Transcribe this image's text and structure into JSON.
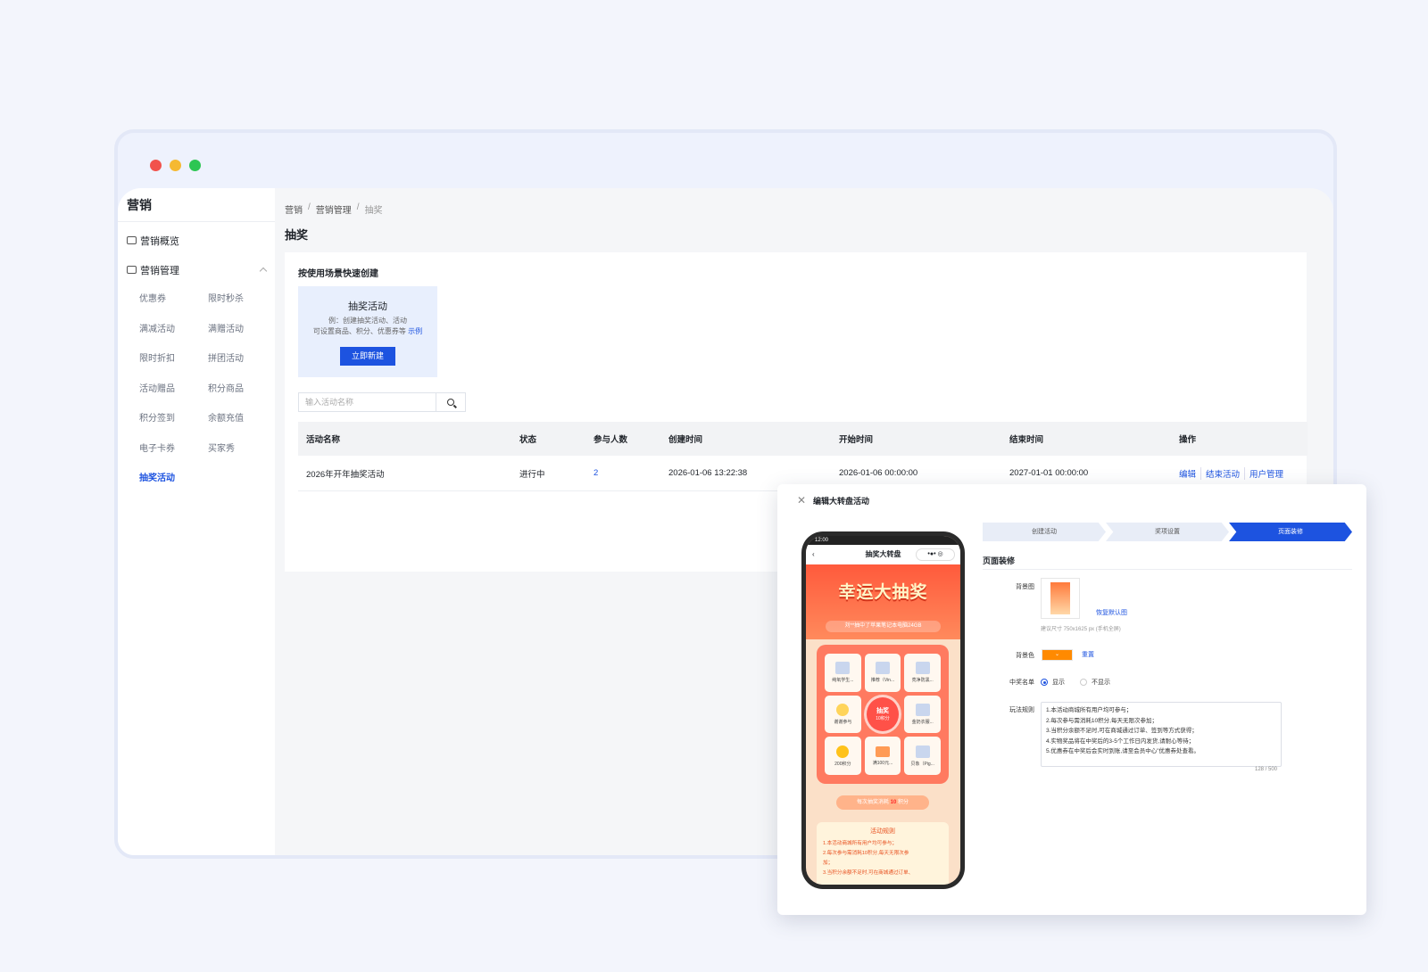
{
  "window": {
    "controls": [
      "close",
      "minimize",
      "maximize"
    ]
  },
  "sidebar": {
    "title": "营销",
    "overview": "营销概览",
    "management": "营销管理",
    "items": [
      "优惠券",
      "限时秒杀",
      "满减活动",
      "满赠活动",
      "限时折扣",
      "拼团活动",
      "活动赠品",
      "积分商品",
      "积分签到",
      "余额充值",
      "电子卡券",
      "买家秀",
      "抽奖活动"
    ],
    "active": "抽奖活动"
  },
  "breadcrumb": [
    "营销",
    "营销管理",
    "抽奖"
  ],
  "page_title": "抽奖",
  "quick_create": {
    "title": "按使用场景快速创建",
    "card_title": "抽奖活动",
    "card_desc_1": "例：创建抽奖活动、活动",
    "card_desc_2": "可设置商品、积分、优惠券等",
    "card_example": "示例",
    "card_button": "立即新建"
  },
  "search": {
    "placeholder": "输入活动名称"
  },
  "table": {
    "headers": [
      "活动名称",
      "状态",
      "参与人数",
      "创建时间",
      "开始时间",
      "结束时间",
      "操作"
    ],
    "rows": [
      {
        "name": "2026年开年抽奖活动",
        "status": "进行中",
        "participants": "2",
        "created": "2026-01-06 13:22:38",
        "start": "2026-01-06 00:00:00",
        "end": "2027-01-01 00:00:00",
        "ops": [
          "编辑",
          "结束活动",
          "用户管理"
        ]
      }
    ]
  },
  "modal": {
    "title": "编辑大转盘活动",
    "steps": [
      "创建活动",
      "奖项设置",
      "页面装修"
    ],
    "active_step": "页面装修",
    "section_title": "页面装修",
    "bg_image_label": "背景图",
    "restore_default": "恢复默认图",
    "size_hint": "建议尺寸 750x1625 px (手机全屏)",
    "bg_color_label": "背景色",
    "bg_color": "#ff8a00",
    "reset": "重置",
    "winners_label": "中奖名单",
    "show": "显示",
    "hide": "不显示",
    "rules_label": "玩法规则",
    "rules": [
      "1.本活动商城所有用户均可参与；",
      "2.每次参与需消耗10积分,每天无限次参加；",
      "3.当积分余额不足时,可在商城通过订单、签到等方式获得；",
      "4.实物奖品将在中奖后的3-5个工作日内发货,请耐心等待；",
      "5.优惠券在中奖后会实时到账,请至会员中心\"优惠券处查看。"
    ],
    "char_count": "128 / 500"
  },
  "phone": {
    "time": "12:00",
    "nav_title": "抽奖大转盘",
    "hero_title": "幸运大抽奖",
    "ticker": "刘**抽中了苹果笔记本电脑24GB",
    "prizes": [
      "纯氧学生...",
      "推荐（Vin...",
      "亮净防黑...",
      "谢谢参与",
      "金奶衣服...",
      "200积分",
      "满100元...",
      "贝象（Pig..."
    ],
    "draw_label": "抽奖",
    "draw_cost": "10积分",
    "cost_prefix": "每次抽奖消耗",
    "cost_value": "10",
    "cost_suffix": "积分",
    "rules_title": "活动规则",
    "rules": [
      "1.本活动商城所有用户均可参与；",
      "2.每次参与需消耗10积分,每天无限次参",
      "加；",
      "3.当积分余额不足时,可在商城通过订单、"
    ]
  }
}
